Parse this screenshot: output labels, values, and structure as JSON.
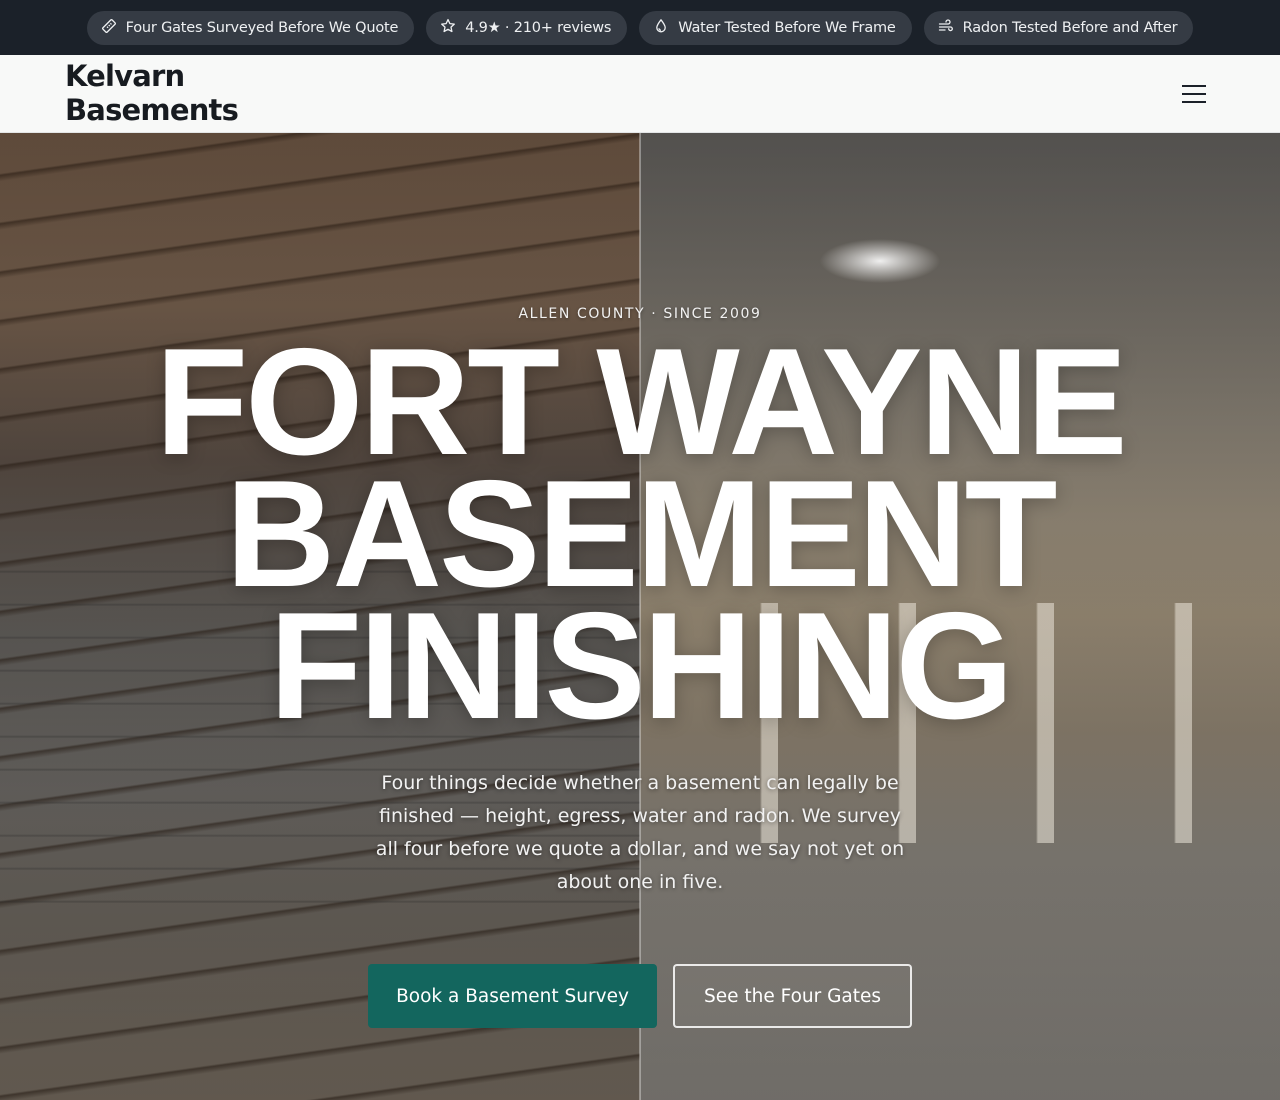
{
  "trust_bar": {
    "items": [
      {
        "icon": "ruler-icon",
        "label": "Four Gates Surveyed Before We Quote"
      },
      {
        "icon": "star-icon",
        "label": "4.9★ · 210+ reviews"
      },
      {
        "icon": "droplet-icon",
        "label": "Water Tested Before We Frame"
      },
      {
        "icon": "wind-icon",
        "label": "Radon Tested Before and After"
      }
    ]
  },
  "header": {
    "logo_line1": "Kelvarn",
    "logo_line2": "Basements",
    "menu_icon": "hamburger-menu-icon"
  },
  "hero": {
    "eyebrow": "ALLEN COUNTY · SINCE 2009",
    "title_line1": "FORT WAYNE",
    "title_line2": "BASEMENT",
    "title_line3": "FINISHING",
    "subtitle": "Four things decide whether a basement can legally be finished — height, egress, water and radon. We survey all four before we quote a dollar, and we say not yet on about one in five.",
    "primary_cta": "Book a Basement Survey",
    "secondary_cta": "See the Four Gates"
  },
  "colors": {
    "topbar_bg": "#1b2129",
    "pill_bg": "#353b44",
    "header_bg": "#f8f9f8",
    "accent": "#13665e"
  }
}
